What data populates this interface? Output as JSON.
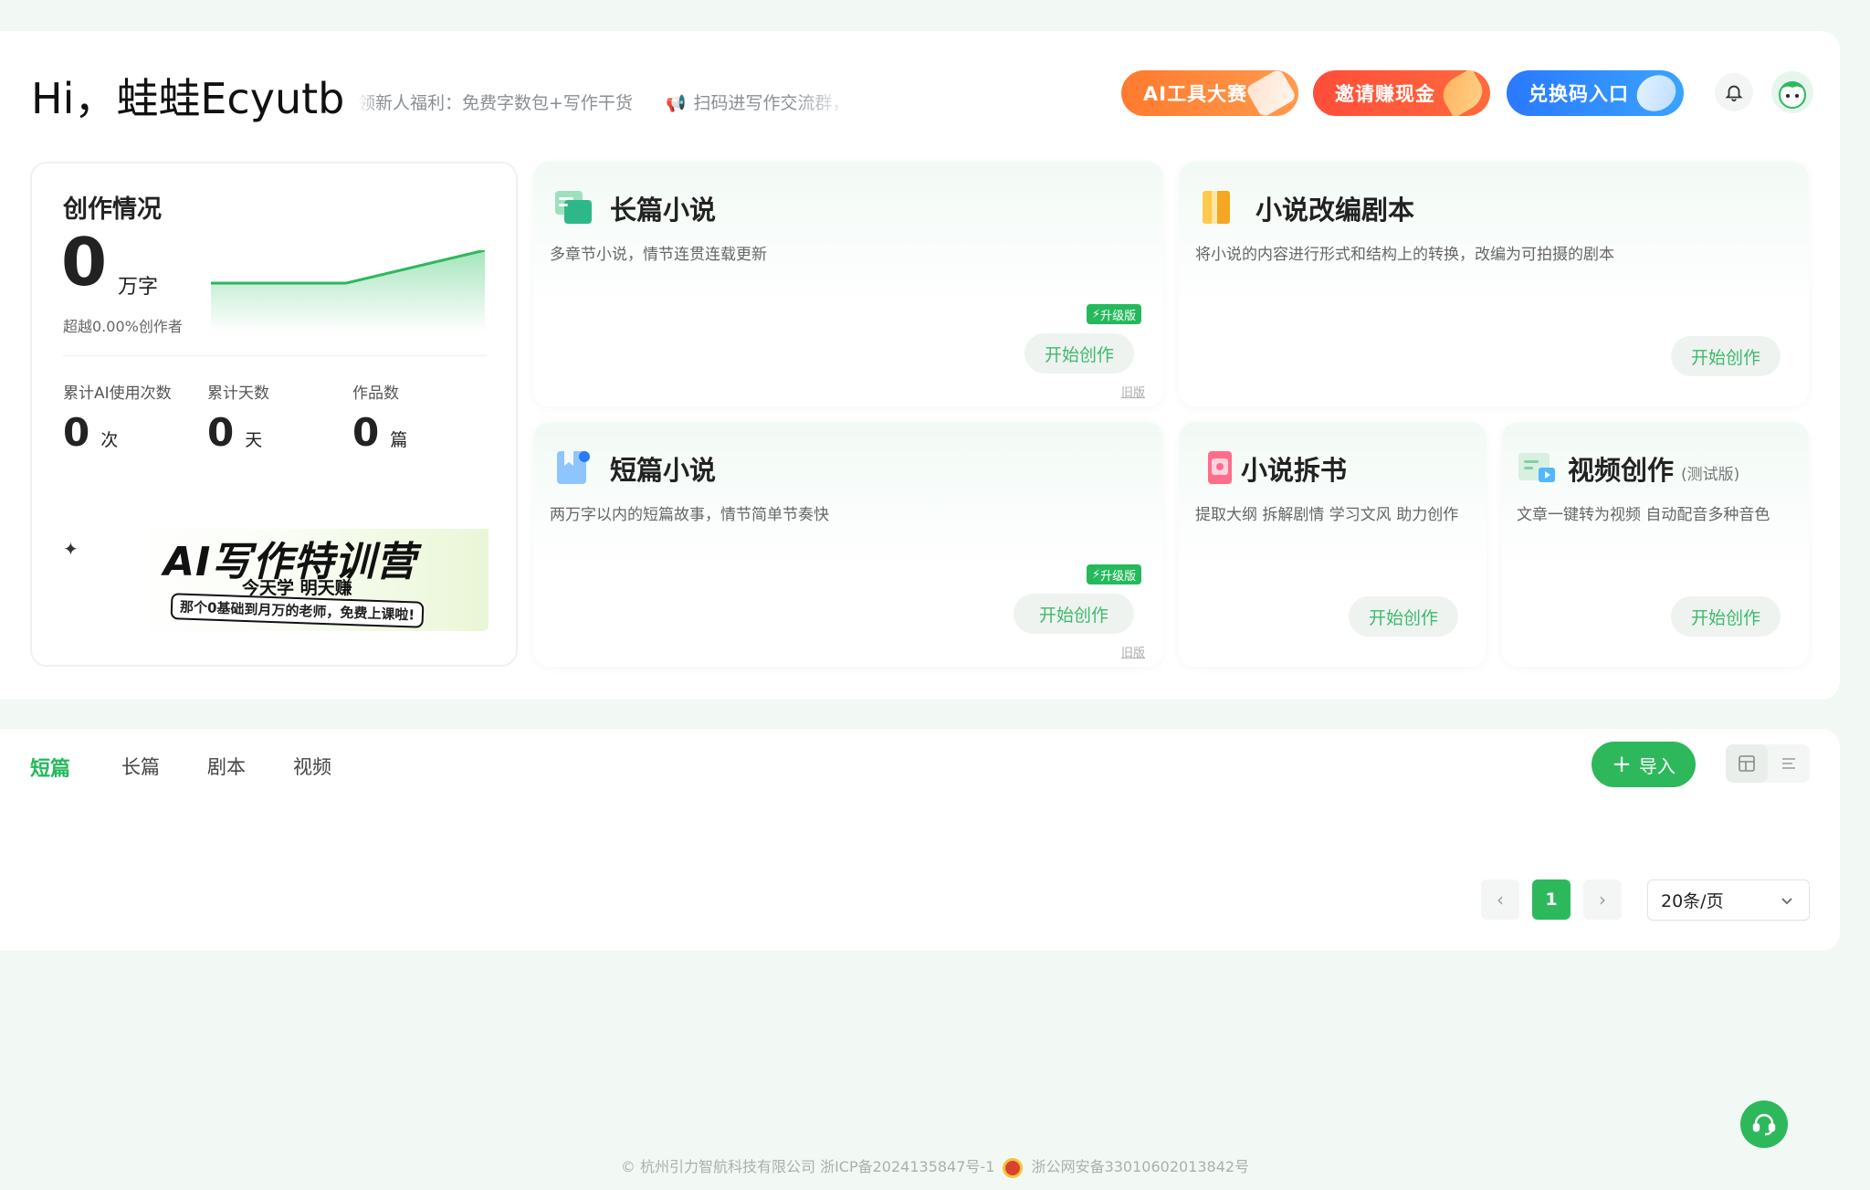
{
  "header": {
    "greeting": "Hi，蛙蛙Ecyutb",
    "ticker_items": [
      "领新人福利：免费字数包+写作干货",
      "扫码进写作交流群，"
    ],
    "promos": {
      "ai_contest": "AI工具大赛",
      "invite": "邀请赚现金",
      "redeem": "兑换码入口"
    }
  },
  "stats": {
    "title": "创作情况",
    "total_words": "0",
    "total_words_unit": "万字",
    "exceed": "超越0.00%创作者",
    "items": [
      {
        "label": "累计AI使用次数",
        "value": "0",
        "unit": "次"
      },
      {
        "label": "累计天数",
        "value": "0",
        "unit": "天"
      },
      {
        "label": "作品数",
        "value": "0",
        "unit": "篇"
      }
    ],
    "banner": {
      "title": "AI写作特训营",
      "subtitle": "今天学 明天赚",
      "pill": "那个0基础到月万的老师，免费上课啦!"
    }
  },
  "features": {
    "long_novel": {
      "title": "长篇小说",
      "desc": "多章节小说，情节连贯连载更新",
      "badge": "升级版",
      "button": "开始创作",
      "old": "旧版"
    },
    "adapt_script": {
      "title": "小说改编剧本",
      "desc": "将小说的内容进行形式和结构上的转换，改编为可拍摄的剧本",
      "button": "开始创作"
    },
    "short_novel": {
      "title": "短篇小说",
      "desc": "两万字以内的短篇故事，情节简单节奏快",
      "badge": "升级版",
      "button": "开始创作",
      "old": "旧版"
    },
    "novel_breakdown": {
      "title": "小说拆书",
      "desc": "提取大纲 拆解剧情 学习文风 助力创作",
      "button": "开始创作"
    },
    "video": {
      "title": "视频创作",
      "tag": "(测试版)",
      "desc": "文章一键转为视频 自动配音多种音色",
      "button": "开始创作"
    }
  },
  "works": {
    "tabs": [
      "短篇",
      "长篇",
      "剧本",
      "视频"
    ],
    "active_tab": "短篇",
    "import_label": "导入",
    "pagination": {
      "current": "1",
      "page_size": "20条/页"
    }
  },
  "footer": {
    "company": "© 杭州引力智航科技有限公司 浙ICP备2024135847号-1",
    "police": "浙公网安备33010602013842号"
  },
  "colors": {
    "accent": "#2eb85c",
    "ai_orange": "#ff7a2e",
    "invite_red": "#ff4d3a",
    "redeem_blue": "#2979ff"
  }
}
